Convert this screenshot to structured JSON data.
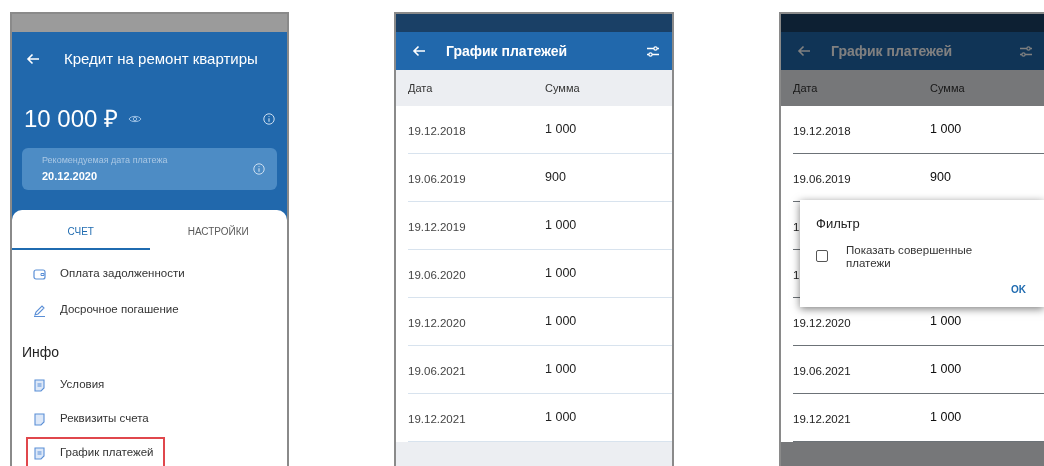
{
  "screens": [
    {
      "kind": "account",
      "title": "Кредит на ремонт квартиры",
      "balance": "10 000 ₽",
      "recommended": {
        "label": "Рекомендуемая дата платежа",
        "value": "20.12.2020"
      },
      "tabs": [
        {
          "label": "СЧЕТ",
          "selected": true
        },
        {
          "label": "НАСТРОЙКИ",
          "selected": false
        }
      ],
      "actions": [
        {
          "label": "Оплата задолженности"
        },
        {
          "label": "Досрочное погашение"
        }
      ],
      "section_title": "Инфо",
      "info_items": [
        {
          "label": "Условия",
          "highlighted": false
        },
        {
          "label": "Реквизиты счета",
          "highlighted": false
        },
        {
          "label": "График платежей",
          "highlighted": true
        }
      ]
    },
    {
      "kind": "schedule",
      "dimmed": false,
      "title": "График платежей",
      "columns": [
        "Дата",
        "Сумма"
      ],
      "rows": [
        {
          "date": "19.12.2018",
          "amount": "1 000"
        },
        {
          "date": "19.06.2019",
          "amount": "900"
        },
        {
          "date": "19.12.2019",
          "amount": "1 000"
        },
        {
          "date": "19.06.2020",
          "amount": "1 000"
        },
        {
          "date": "19.12.2020",
          "amount": "1 000"
        },
        {
          "date": "19.06.2021",
          "amount": "1 000"
        },
        {
          "date": "19.12.2021",
          "amount": "1 000"
        }
      ]
    },
    {
      "kind": "schedule",
      "dimmed": true,
      "title": "График платежей",
      "columns": [
        "Дата",
        "Сумма"
      ],
      "rows": [
        {
          "date": "19.12.2018",
          "amount": "1 000"
        },
        {
          "date": "19.06.2019",
          "amount": "900"
        },
        {
          "date": "1"
        },
        {
          "date": "1"
        },
        {
          "date": "19.12.2020",
          "amount": "1 000"
        },
        {
          "date": "19.06.2021",
          "amount": "1 000"
        },
        {
          "date": "19.12.2021",
          "amount": "1 000"
        }
      ],
      "dialog": {
        "title": "Фильтр",
        "option": {
          "label": "Показать совершенные платежи",
          "checked": false
        },
        "button": "OK"
      }
    }
  ]
}
